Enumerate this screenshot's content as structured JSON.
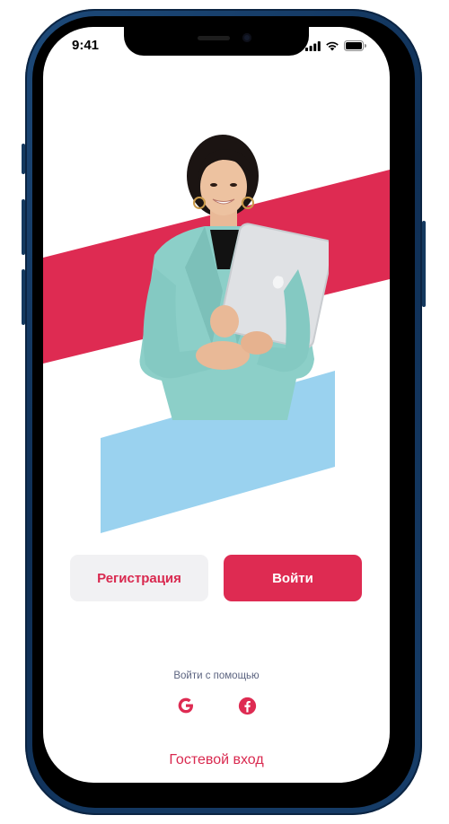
{
  "status_bar": {
    "time": "9:41"
  },
  "colors": {
    "accent": "#de2b52",
    "secondary": "#9ad2ef",
    "muted_button": "#f1f1f3",
    "muted_text": "#5c6480"
  },
  "buttons": {
    "register_label": "Регистрация",
    "login_label": "Войти"
  },
  "social_login": {
    "caption": "Войти с помощью",
    "providers": [
      {
        "name": "google-icon"
      },
      {
        "name": "facebook-icon"
      }
    ]
  },
  "guest_login_label": "Гостевой вход"
}
